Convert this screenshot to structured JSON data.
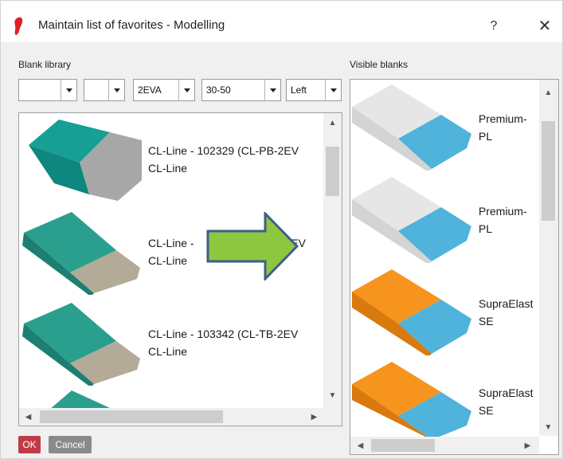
{
  "window": {
    "title": "Maintain list of favorites - Modelling",
    "help_label": "?",
    "close_label": "✕",
    "brand_color": "#e01e25",
    "icons": [
      "footprint-icon",
      "help-icon",
      "close-icon"
    ]
  },
  "left_panel": {
    "label": "Blank library",
    "filters": [
      {
        "value": ""
      },
      {
        "value": ""
      },
      {
        "value": "2EVA"
      },
      {
        "value": "30-50"
      },
      {
        "value": "Left"
      }
    ],
    "items": [
      {
        "line1": "CL-Line - 102329 (CL-PB-2EV",
        "line2": "CL-Line",
        "colors": {
          "a": "#169f95",
          "b": "#a7a7a7"
        }
      },
      {
        "line1": "CL-Line - ",
        "line1b": "B-2EV",
        "line2": "CL-Line",
        "colors": {
          "a": "#2a9f8e",
          "b": "#b3aa97"
        }
      },
      {
        "line1": "CL-Line - 103342 (CL-TB-2EV",
        "line2": "CL-Line",
        "colors": {
          "a": "#2a9f8e",
          "b": "#b3aa97"
        }
      },
      {
        "line1": "",
        "line2": "",
        "colors": {
          "a": "#2a9f8e",
          "b": "#b3aa97"
        }
      }
    ]
  },
  "right_panel": {
    "label": "Visible blanks",
    "items": [
      {
        "line1": "Premium-",
        "line2": "PL",
        "colors": {
          "a": "#e6e6e6",
          "b": "#4fb3db"
        }
      },
      {
        "line1": "Premium-",
        "line2": "PL",
        "colors": {
          "a": "#e6e6e6",
          "b": "#4fb3db"
        }
      },
      {
        "line1": "SupraElast",
        "line2": "SE",
        "colors": {
          "a": "#f7941d",
          "b": "#4fb3db"
        }
      },
      {
        "line1": "SupraElast",
        "line2": "SE",
        "colors": {
          "a": "#f7941d",
          "b": "#4fb3db"
        }
      }
    ]
  },
  "buttons": {
    "ok": "OK",
    "cancel": "Cancel",
    "ok_color": "#c23a47",
    "cancel_color": "#8a8a8a"
  },
  "overlay": {
    "icon": "arrow-right-icon",
    "fill": "#8dc63f",
    "stroke": "#3d5f8a"
  }
}
